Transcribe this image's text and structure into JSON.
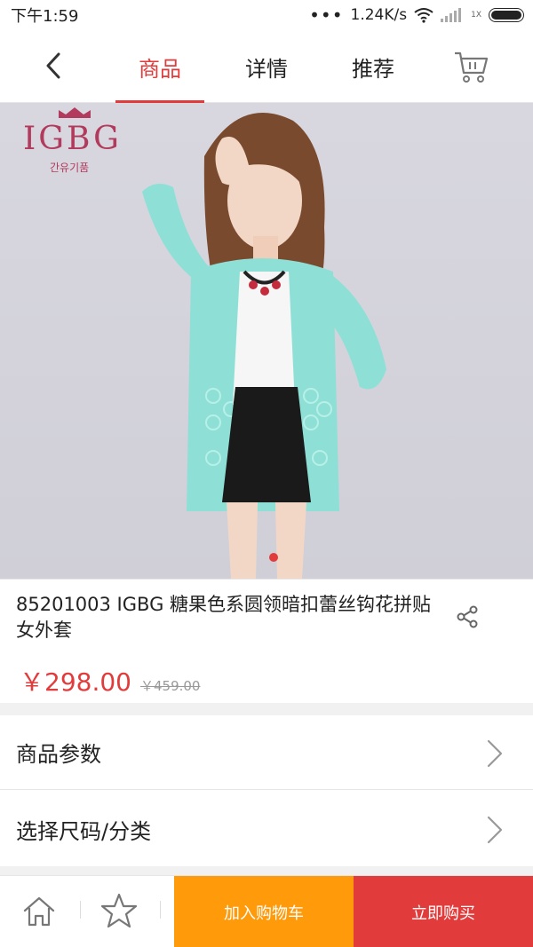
{
  "status_bar": {
    "time": "下午1:59",
    "dots": "•••",
    "speed": "1.24K/s",
    "signal_label": "1X"
  },
  "header": {
    "tabs": [
      {
        "label": "商品",
        "active": true
      },
      {
        "label": "详情",
        "active": false
      },
      {
        "label": "推荐",
        "active": false
      }
    ],
    "accent_color": "#e23b3b"
  },
  "hero": {
    "brand_name": "IGBG",
    "brand_sub": "간유기품",
    "carousel_index": 1,
    "carousel_total": 1
  },
  "product": {
    "title": "85201003 IGBG  糖果色系圆领暗扣蕾丝钩花拼贴女外套",
    "price_now": "￥298.00",
    "price_old": "￥459.00"
  },
  "rows": {
    "params_label": "商品参数",
    "size_label": "选择尺码/分类"
  },
  "bottom_bar": {
    "add_to_cart": "加入购物车",
    "buy_now": "立即购买",
    "cart_color": "#ff9a0a",
    "buy_color": "#e23b3b"
  }
}
